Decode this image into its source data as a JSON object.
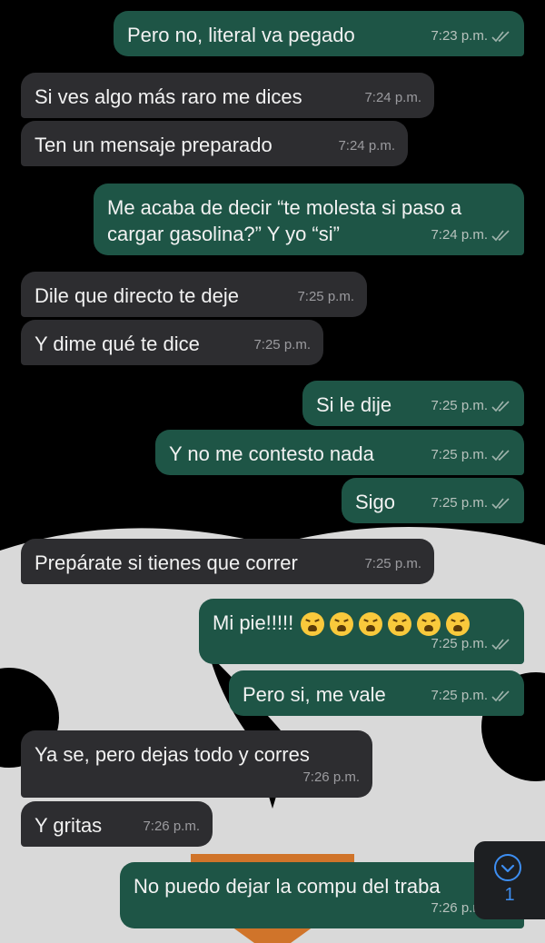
{
  "colors": {
    "outgoing_bubble": "#1e5546",
    "incoming_bubble": "#2d2d30",
    "accent": "#3d8ef2",
    "wallpaper_light": "#d9d9d9",
    "wallpaper_dark": "#000000"
  },
  "messages": [
    {
      "text": "Pero no, literal va pegado",
      "time": "7:23 p.m.",
      "direction": "out",
      "status": "read"
    },
    {
      "text": "Si ves algo más raro me dices",
      "time": "7:24 p.m.",
      "direction": "in"
    },
    {
      "text": "Ten un mensaje preparado",
      "time": "7:24 p.m.",
      "direction": "in"
    },
    {
      "text_line1": "Me acaba de decir “te molesta si paso a",
      "text_line2": "cargar gasolina?” Y yo “si”",
      "time": "7:24 p.m.",
      "direction": "out",
      "status": "read"
    },
    {
      "text": "Dile que directo te deje",
      "time": "7:25 p.m.",
      "direction": "in"
    },
    {
      "text": "Y dime qué te dice",
      "time": "7:25 p.m.",
      "direction": "in"
    },
    {
      "text": "Si le dije",
      "time": "7:25 p.m.",
      "direction": "out",
      "status": "read"
    },
    {
      "text": "Y no me contesto nada",
      "time": "7:25 p.m.",
      "direction": "out",
      "status": "read"
    },
    {
      "text": "Sigo",
      "time": "7:25 p.m.",
      "direction": "out",
      "status": "read"
    },
    {
      "text": "Prepárate si tienes que correr",
      "time": "7:25 p.m.",
      "direction": "in"
    },
    {
      "text": "Mi pie!!!!!",
      "emoji": "weary-face",
      "emoji_count": 6,
      "time": "7:25 p.m.",
      "direction": "out",
      "status": "read"
    },
    {
      "text": "Pero si, me vale",
      "time": "7:25 p.m.",
      "direction": "out",
      "status": "read"
    },
    {
      "text": "Ya se, pero dejas todo y corres",
      "time": "7:26 p.m.",
      "direction": "in"
    },
    {
      "text": "Y gritas",
      "time": "7:26 p.m.",
      "direction": "in"
    },
    {
      "text": "No puedo dejar la compu del traba",
      "time": "7:26 p.m.",
      "direction": "out",
      "status": "read"
    }
  ],
  "scroll_button": {
    "icon": "chevron-down-icon",
    "unread_count": "1"
  }
}
